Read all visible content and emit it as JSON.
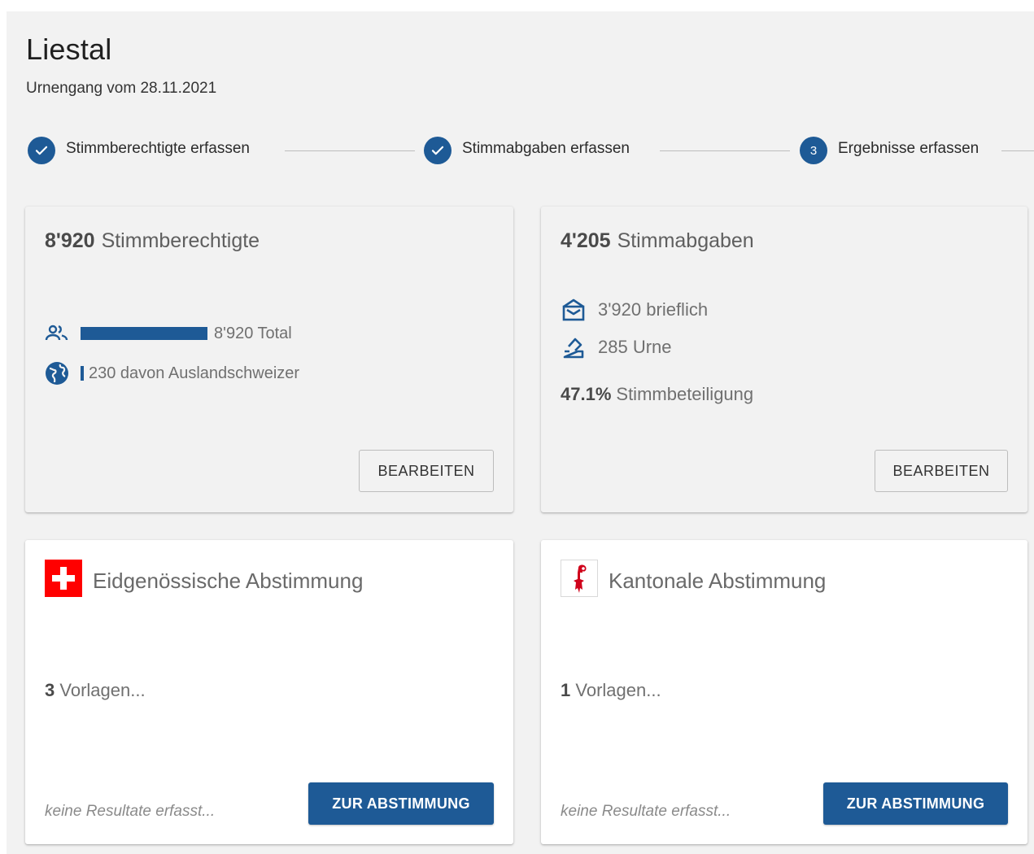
{
  "header": {
    "title": "Liestal",
    "subtitle": "Urnengang vom 28.11.2021"
  },
  "stepper": {
    "steps": [
      {
        "label": "Stimmberechtigte erfassen",
        "state": "completed",
        "icon": "check-icon"
      },
      {
        "label": "Stimmabgaben erfassen",
        "state": "completed",
        "icon": "check-icon"
      },
      {
        "label": "Ergebnisse erfassen",
        "state": "active",
        "number": "3"
      }
    ]
  },
  "eligible_card": {
    "count": "8'920",
    "label": "Stimmberechtigte",
    "total_text": "8'920 Total",
    "abroad_text": "230 davon Auslandschweizer",
    "total_value": 8920,
    "abroad_value": 230,
    "edit_label": "BEARBEITEN",
    "icons": [
      "people-icon",
      "globe-icon"
    ]
  },
  "votes_card": {
    "count": "4'205",
    "label": "Stimmabgaben",
    "mail_text": "3'920 brieflich",
    "urn_text": "285 Urne",
    "turnout_value": "47.1%",
    "turnout_label": "Stimmbeteiligung",
    "edit_label": "BEARBEITEN",
    "icons": [
      "envelope-icon",
      "ballot-box-icon"
    ]
  },
  "federal_card": {
    "title": "Eidgenössische Abstimmung",
    "count": "3",
    "vorlagen_label": "Vorlagen...",
    "status": "keine Resultate erfasst...",
    "button_label": "ZUR ABSTIMMUNG",
    "icon": "swiss-flag-icon"
  },
  "cantonal_card": {
    "title": "Kantonale Abstimmung",
    "count": "1",
    "vorlagen_label": "Vorlagen...",
    "status": "keine Resultate erfasst...",
    "button_label": "ZUR ABSTIMMUNG",
    "icon": "basel-land-flag-icon"
  },
  "colors": {
    "primary": "#1e5a96",
    "background": "#f2f2f2",
    "card_white": "#ffffff",
    "swiss_red": "#ff0000",
    "basel_red": "#d0021b"
  }
}
